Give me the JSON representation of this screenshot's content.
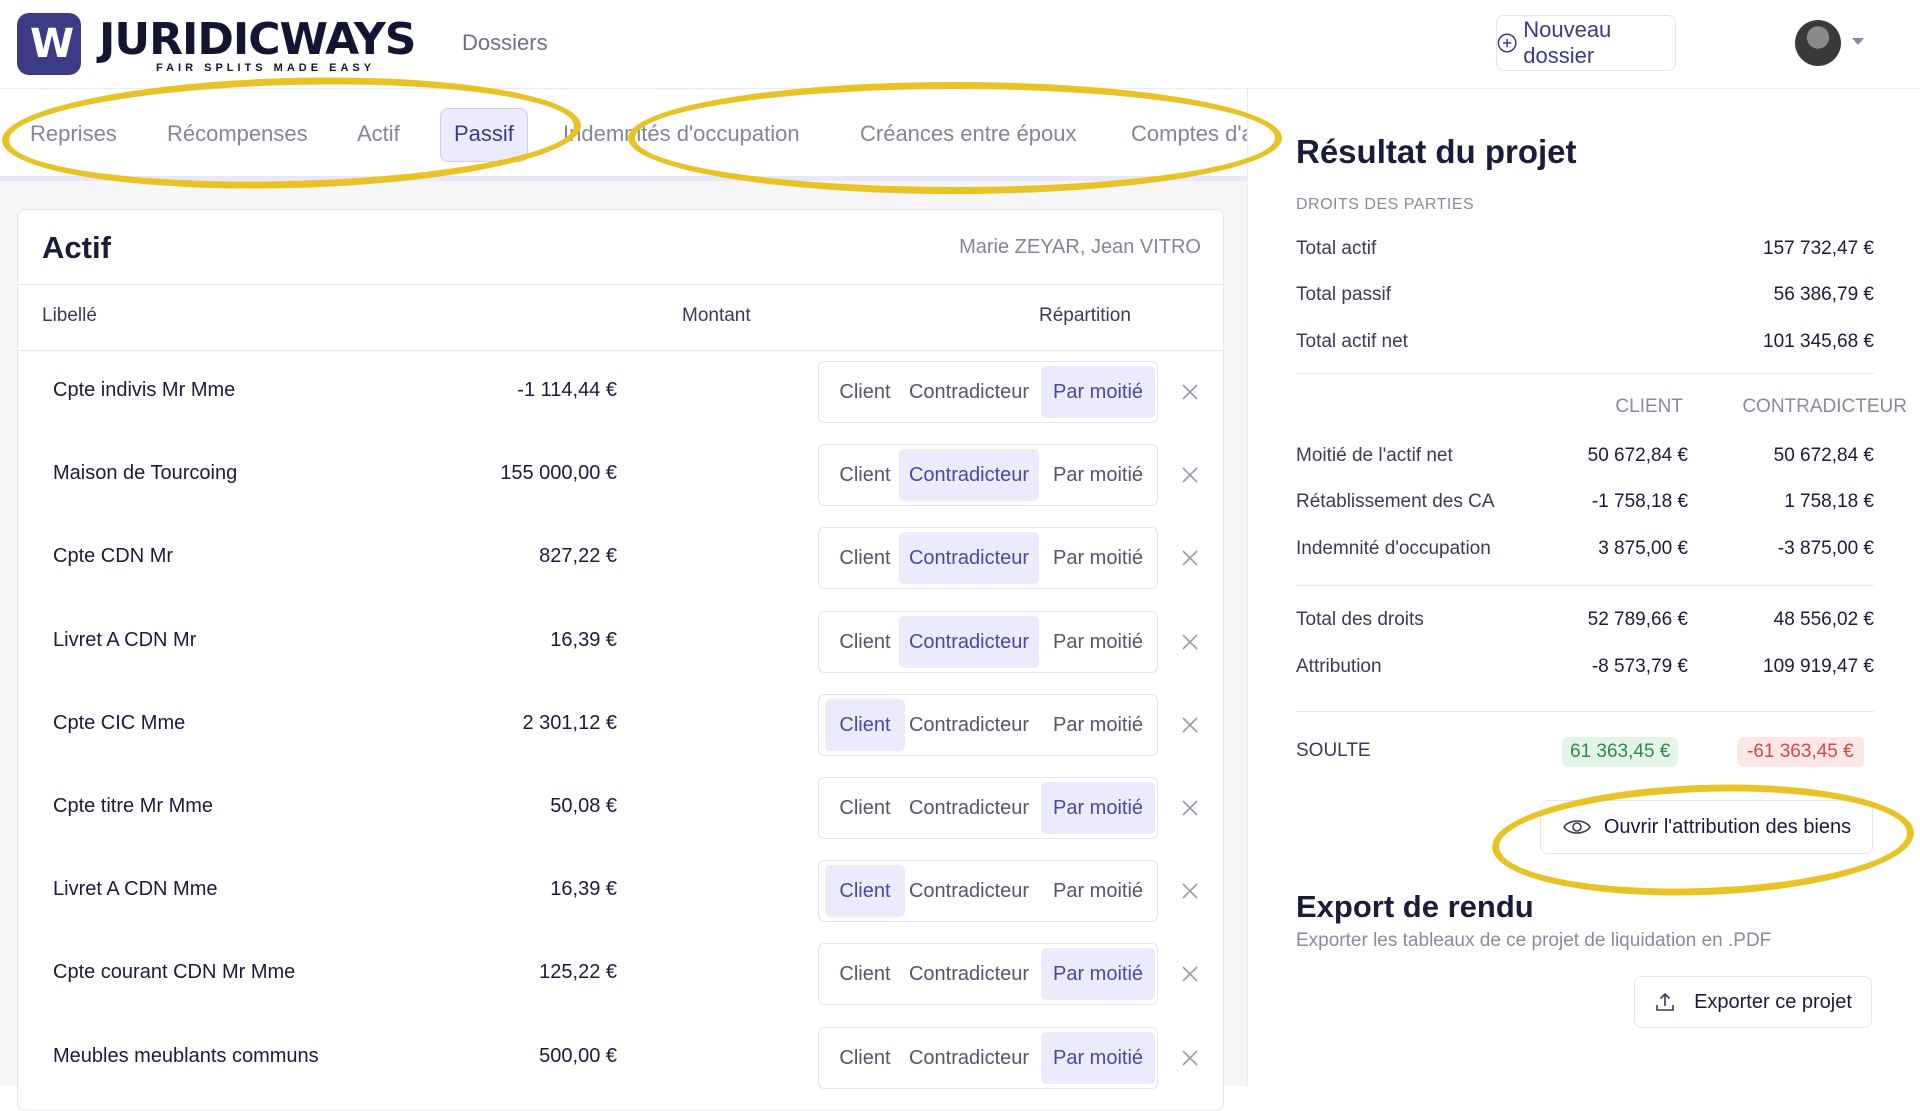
{
  "brand": {
    "logo_mark": "W",
    "name": "JURIDICWAYS",
    "tagline": "FAIR SPLITS MADE EASY"
  },
  "nav": {
    "dossiers": "Dossiers",
    "new_dossier": "Nouveau dossier"
  },
  "tabs": [
    "Reprises",
    "Récompenses",
    "Actif",
    "Passif",
    "Indemnités d'occupation",
    "Créances entre époux",
    "Comptes d'administration"
  ],
  "active_tab": "Passif",
  "highlight_color": "#e9c224",
  "card": {
    "title": "Actif",
    "parties": "Marie ZEYAR, Jean VITRO",
    "columns": {
      "label": "Libellé",
      "amount": "Montant",
      "split": "Répartition"
    },
    "options": {
      "client": "Client",
      "contra": "Contradicteur",
      "half": "Par moitié"
    },
    "rows": [
      {
        "label": "Cpte indivis Mr Mme",
        "amount": "-1 114,44 €",
        "selected": "Par moitié"
      },
      {
        "label": "Maison de Tourcoing",
        "amount": "155 000,00 €",
        "selected": "Contradicteur"
      },
      {
        "label": "Cpte CDN Mr",
        "amount": "827,22 €",
        "selected": "Contradicteur"
      },
      {
        "label": "Livret A CDN Mr",
        "amount": "16,39 €",
        "selected": "Contradicteur"
      },
      {
        "label": "Cpte CIC Mme",
        "amount": "2 301,12 €",
        "selected": "Client"
      },
      {
        "label": "Cpte titre Mr Mme",
        "amount": "50,08 €",
        "selected": "Par moitié"
      },
      {
        "label": "Livret A CDN Mme",
        "amount": "16,39 €",
        "selected": "Client"
      },
      {
        "label": "Cpte courant CDN Mr Mme",
        "amount": "125,22 €",
        "selected": "Par moitié"
      },
      {
        "label": "Meubles meublants communs",
        "amount": "500,00 €",
        "selected": "Par moitié"
      }
    ]
  },
  "result": {
    "title": "Résultat du projet",
    "subtitle": "DROITS DES PARTIES",
    "totals": [
      {
        "label": "Total actif",
        "value": "157 732,47 €"
      },
      {
        "label": "Total passif",
        "value": "56 386,79 €"
      },
      {
        "label": "Total actif net",
        "value": "101 345,68 €"
      }
    ],
    "col_client": "CLIENT",
    "col_contra": "CONTRADICTEUR",
    "rights": [
      {
        "label": "Moitié de l'actif net",
        "client": "50 672,84 €",
        "contra": "50 672,84 €"
      },
      {
        "label": "Rétablissement des CA",
        "client": "-1 758,18 €",
        "contra": "1 758,18 €"
      },
      {
        "label": "Indemnité d'occupation",
        "client": "3 875,00 €",
        "contra": "-3 875,00 €"
      }
    ],
    "summary": [
      {
        "label": "Total des droits",
        "client": "52 789,66 €",
        "contra": "48 556,02 €"
      },
      {
        "label": "Attribution",
        "client": "-8 573,79 €",
        "contra": "109 919,47 €"
      }
    ],
    "soulte": {
      "label": "SOULTE",
      "client": "61 363,45 €",
      "contra": "-61 363,45 €"
    },
    "open_attribution": "Ouvrir l'attribution des biens"
  },
  "export": {
    "title": "Export de rendu",
    "description": "Exporter les tableaux de ce projet de liquidation en .PDF",
    "button": "Exporter ce projet"
  }
}
